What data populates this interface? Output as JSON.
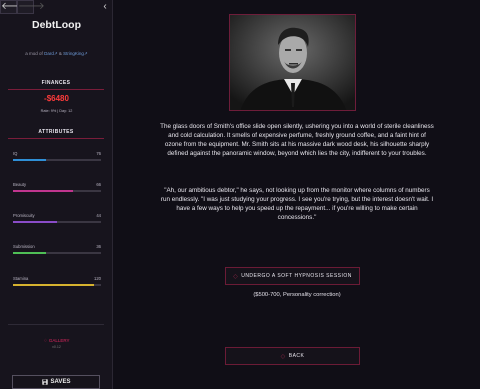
{
  "nav": {
    "back": "🡐",
    "forward": "🡒",
    "collapse": "‹"
  },
  "app": {
    "title": "DebtLoop",
    "credits_prefix": "a mod of",
    "credits_link1": "Dard",
    "credits_mid": "& ",
    "credits_link2": "StringKing"
  },
  "finances": {
    "heading": "FINANCES",
    "money": "-$6480",
    "rate": "Rate: 9% | Day: 12"
  },
  "attributes": {
    "heading": "ATTRIBUTES",
    "items": [
      {
        "label": "IQ",
        "value": "76",
        "level": 0.38,
        "color": "#2f8fd6"
      },
      {
        "label": "Beauty",
        "value": "66",
        "level": 0.68,
        "color": "#c0358e"
      },
      {
        "label": "Promiscuity",
        "value": "44",
        "level": 0.5,
        "color": "#8a4cc8"
      },
      {
        "label": "Submission",
        "value": "36",
        "level": 0.38,
        "color": "#4fbf56"
      },
      {
        "label": "Stamina",
        "value": "120",
        "level": 0.92,
        "color": "#d6b22f"
      }
    ]
  },
  "footer": {
    "gallery": "GALLERY",
    "version": "v0.12",
    "saves": "SAVES"
  },
  "story": {
    "paragraph1": "The glass doors of Smith's office slide open silently, ushering you into a world of sterile cleanliness and cold calculation. It smells of expensive perfume, freshly ground coffee, and a faint hint of ozone from the equipment. Mr. Smith sits at his massive dark wood desk, his silhouette sharply defined against the panoramic window, beyond which lies the city, indifferent to your troubles.",
    "paragraph2": "\"Ah, our ambitious debtor,\" he says, not looking up from the monitor where columns of numbers run endlessly. \"I was just studying your progress. I see you're trying, but the interest doesn't wait. I have a few ways to help you speed up the repayment... if you're willing to make certain concessions.\""
  },
  "actions": {
    "hypnosis": "UNDERGO A SOFT HYPNOSIS SESSION",
    "hypnosis_note": "($500-700, Personality correction)",
    "back": "BACK"
  }
}
